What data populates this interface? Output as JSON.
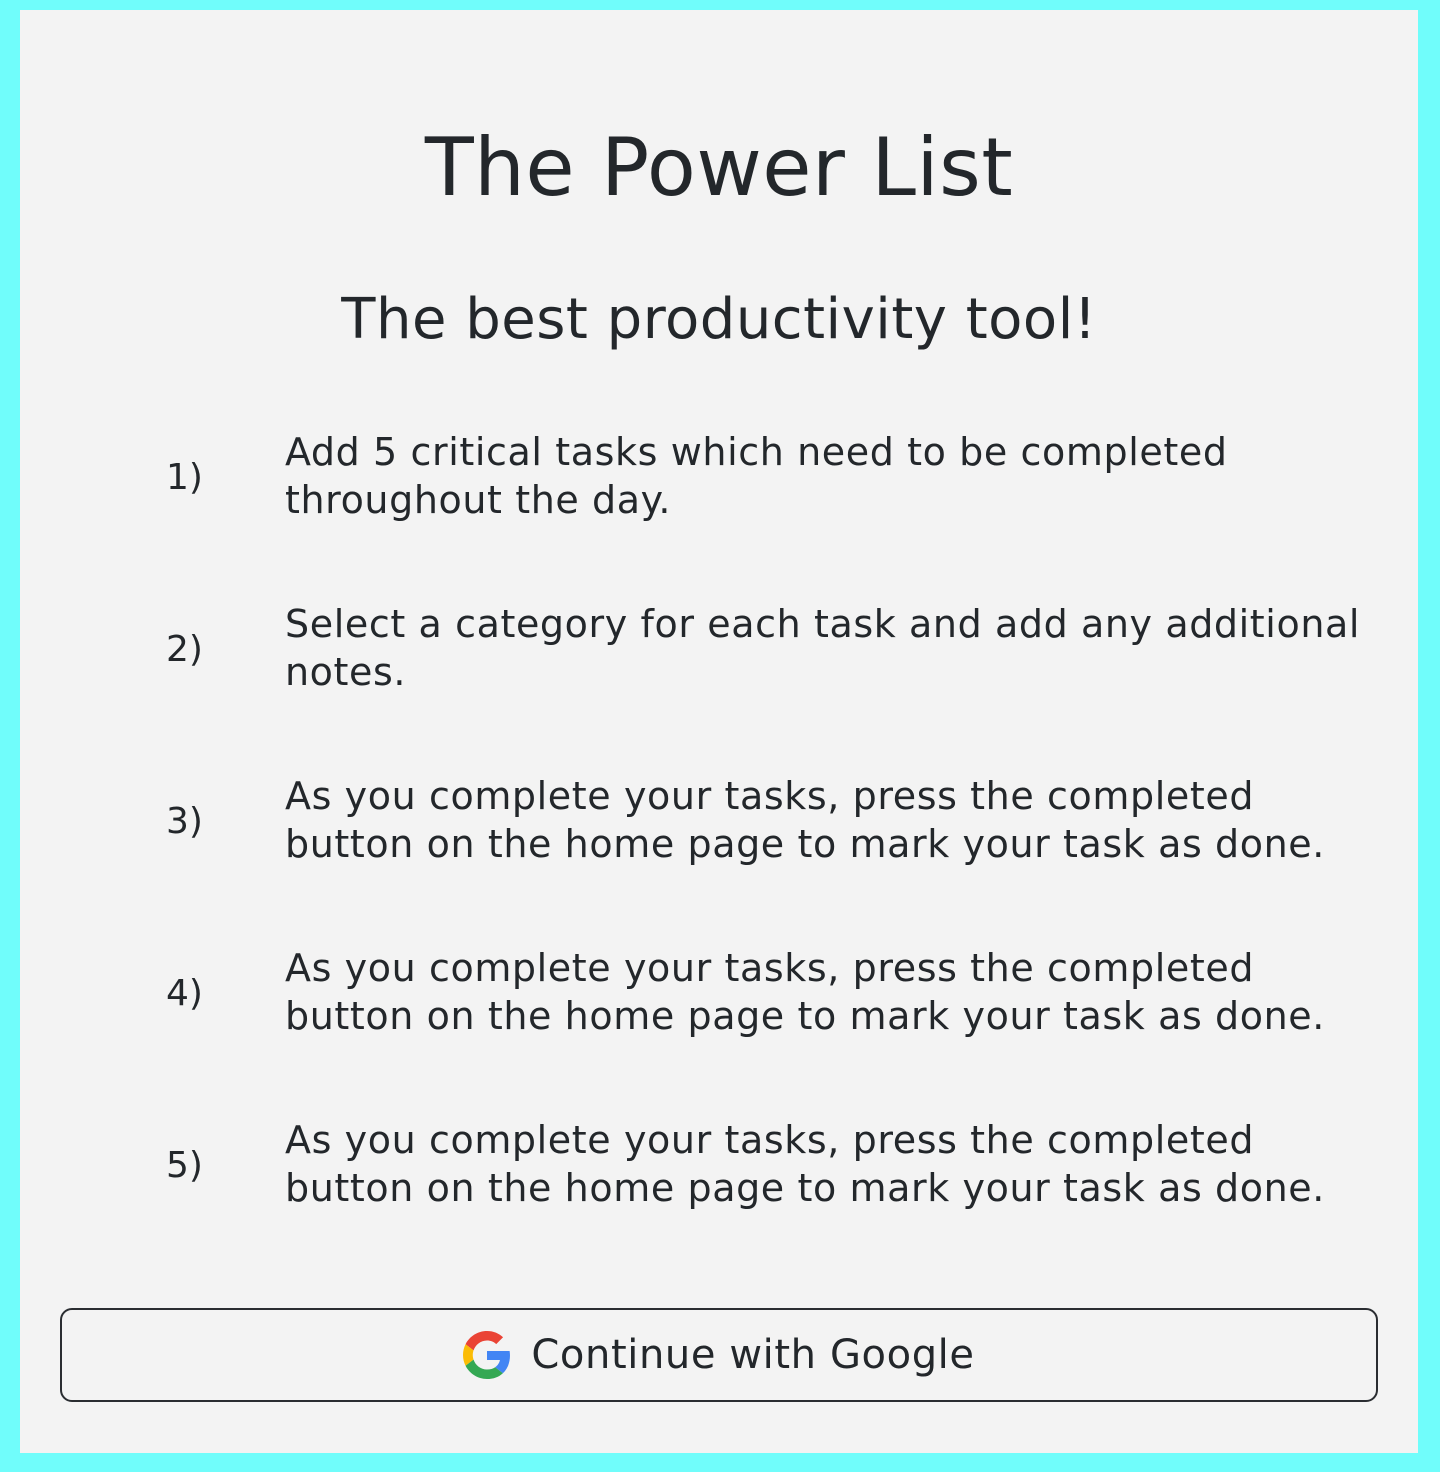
{
  "page": {
    "background_color": "#70fdfb",
    "card_color": "#f3f3f3"
  },
  "header": {
    "title": "The Power List",
    "subtitle": "The best productivity tool!"
  },
  "steps": [
    {
      "number": "1)",
      "text": "Add 5 critical tasks which need to be completed throughout the day."
    },
    {
      "number": "2)",
      "text": "Select a category for each task and add any additional notes."
    },
    {
      "number": "3)",
      "text": "As you complete your tasks, press the completed button on the home page to mark your task as done."
    },
    {
      "number": "4)",
      "text": "As you complete your tasks, press the completed button on the home page to mark your task as done."
    },
    {
      "number": "5)",
      "text": "As you complete your tasks, press the completed button on the home page to mark your task as done."
    }
  ],
  "auth": {
    "google_button_label": "Continue with Google",
    "google_icon": "google-icon"
  }
}
